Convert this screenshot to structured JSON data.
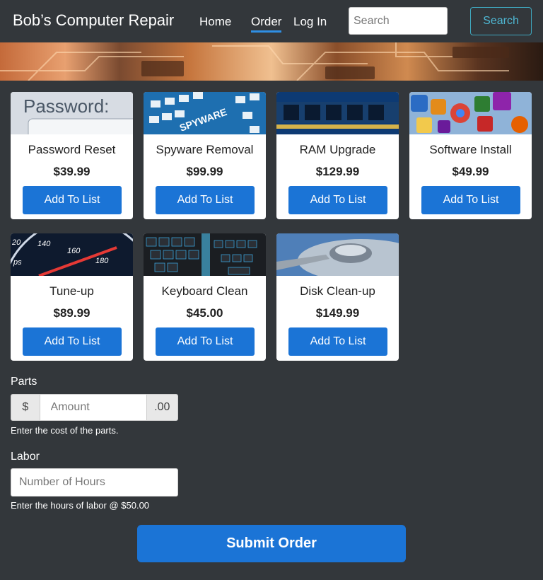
{
  "navbar": {
    "brand": "Bob’s Computer Repair",
    "links": [
      "Home",
      "Order",
      "Log In"
    ],
    "search_placeholder": "Search",
    "search_button": "Search"
  },
  "services": [
    {
      "title": "Password Reset",
      "price": "$39.99",
      "button": "Add To List",
      "image_text": "Password:"
    },
    {
      "title": "Spyware Removal",
      "price": "$99.99",
      "button": "Add To List",
      "image_text": "SPYWARE"
    },
    {
      "title": "RAM Upgrade",
      "price": "$129.99",
      "button": "Add To List"
    },
    {
      "title": "Software Install",
      "price": "$49.99",
      "button": "Add To List"
    },
    {
      "title": "Tune-up",
      "price": "$89.99",
      "button": "Add To List",
      "image_ticks": [
        "20",
        "140",
        "160",
        "180",
        "ps"
      ]
    },
    {
      "title": "Keyboard Clean",
      "price": "$45.00",
      "button": "Add To List"
    },
    {
      "title": "Disk Clean-up",
      "price": "$149.99",
      "button": "Add To List"
    }
  ],
  "form": {
    "parts": {
      "label": "Parts",
      "prefix": "$",
      "placeholder": "Amount",
      "suffix": ".00",
      "help": "Enter the cost of the parts."
    },
    "labor": {
      "label": "Labor",
      "placeholder": "Number of Hours",
      "help": "Enter the hours of labor @ $50.00"
    },
    "submit": "Submit Order"
  },
  "colors": {
    "background": "#33373b",
    "primary": "#1b74d6",
    "search_outline": "#4fb8d4"
  }
}
